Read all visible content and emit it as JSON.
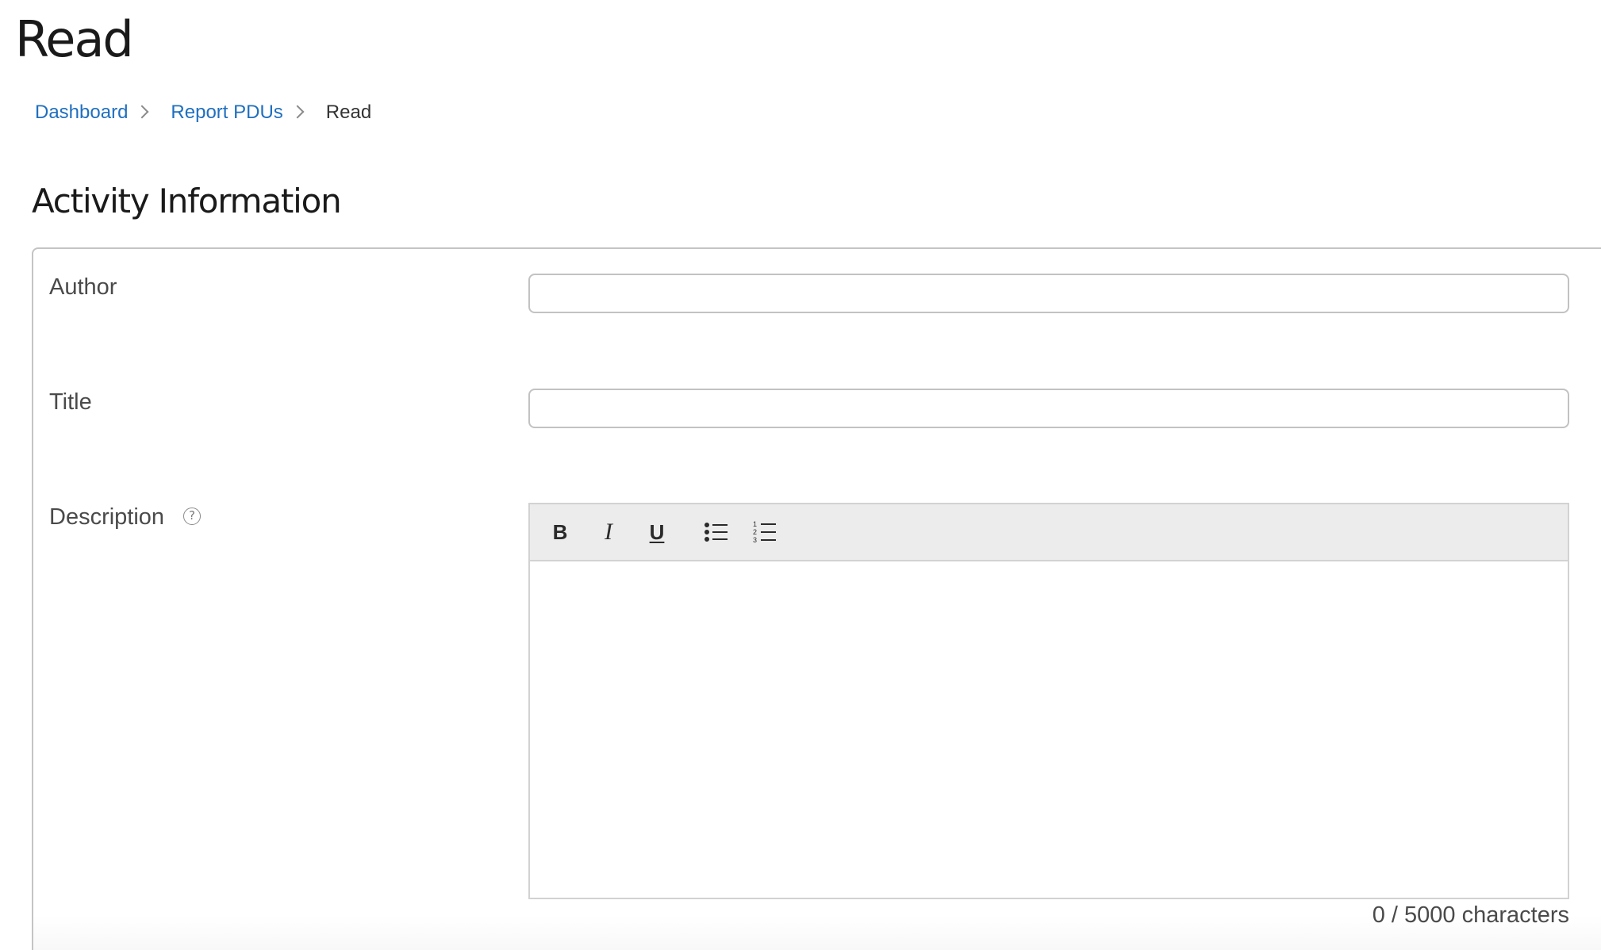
{
  "page": {
    "title": "Read"
  },
  "breadcrumb": {
    "items": [
      {
        "label": "Dashboard"
      },
      {
        "label": "Report PDUs"
      }
    ],
    "current": "Read"
  },
  "section": {
    "title": "Activity Information"
  },
  "form": {
    "author": {
      "label": "Author",
      "value": ""
    },
    "title": {
      "label": "Title",
      "value": ""
    },
    "description": {
      "label": "Description",
      "help_icon": "question-circle-icon",
      "toolbar": {
        "bold": "B",
        "italic": "I",
        "underline": "U",
        "bullet_list_icon": "bulleted-list-icon",
        "numbered_list_icon": "numbered-list-icon"
      },
      "value": "",
      "char_count": {
        "current": "0",
        "separator": " / ",
        "max": "5000",
        "suffix": " characters"
      }
    }
  },
  "colors": {
    "link": "#1f6fbf",
    "text": "#333333",
    "border": "#c2c2c2",
    "toolbar_bg": "#ececec"
  }
}
